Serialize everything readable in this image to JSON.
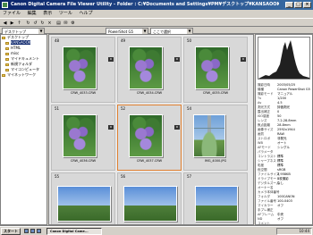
{
  "window": {
    "title": "Canon Digital Camera File Viewer Utility - Folder : C:¥Documents and Settings¥PM¥デスクトップ¥KANSAOOK"
  },
  "menu": [
    "ファイル",
    "編集",
    "表示",
    "ツール",
    "ヘルプ"
  ],
  "toolbar": {
    "address_value": "デスクトップ",
    "sort_value": "PowerShot G5",
    "filter_value": "ここで選択"
  },
  "tree": [
    {
      "label": "デスクトップ",
      "selected": false
    },
    {
      "label": "KANSAOOK",
      "selected": true
    },
    {
      "label": "HTML",
      "selected": false
    },
    {
      "label": "misc",
      "selected": false
    },
    {
      "label": "マイドキュメント",
      "selected": false
    },
    {
      "label": "新規フォルダ",
      "selected": false
    },
    {
      "label": "マイコンピュータ",
      "selected": false
    },
    {
      "label": "マイネットワーク",
      "selected": false
    }
  ],
  "thumbnails": [
    {
      "num": "48",
      "file": "CRW_4033.CRW",
      "kind": "flowers",
      "selected": false
    },
    {
      "num": "49",
      "file": "CRW_4034.CRW",
      "kind": "flowers",
      "selected": false
    },
    {
      "num": "50",
      "file": "CRW_4035.CRW",
      "kind": "flowers",
      "selected": false
    },
    {
      "num": "51",
      "file": "CRW_4036.CRW",
      "kind": "flowers",
      "selected": false
    },
    {
      "num": "52",
      "file": "CRW_4037.CRW",
      "kind": "flowers",
      "selected": true
    },
    {
      "num": "54",
      "file": "IMG_4000.JPG",
      "kind": "fountain",
      "selected": false
    },
    {
      "num": "55",
      "file": "",
      "kind": "landscape",
      "selected": false
    },
    {
      "num": "56",
      "file": "",
      "kind": "landscape",
      "selected": false
    },
    {
      "num": "57",
      "file": "",
      "kind": "landscape",
      "selected": false
    }
  ],
  "properties": [
    {
      "k": "撮影日時",
      "v": "2003/05/25"
    },
    {
      "k": "機種",
      "v": "Canon PowerShot G5"
    },
    {
      "k": "撮影モード",
      "v": "マニュアル"
    },
    {
      "k": "Tv",
      "v": "1/200"
    },
    {
      "k": "Av",
      "v": "4.5"
    },
    {
      "k": "測光方式",
      "v": "評価測光"
    },
    {
      "k": "露出補正",
      "v": "0"
    },
    {
      "k": "ISO感度",
      "v": "50"
    },
    {
      "k": "レンズ",
      "v": "7.2-28.8mm"
    },
    {
      "k": "焦点距離",
      "v": "28.8mm"
    },
    {
      "k": "画像サイズ",
      "v": "2592x1944"
    },
    {
      "k": "画質",
      "v": "RAW"
    },
    {
      "k": "ストロボ",
      "v": "非発光"
    },
    {
      "k": "WB",
      "v": "オート"
    },
    {
      "k": "AFモード",
      "v": "シングル"
    },
    {
      "k": "パラメータ",
      "v": ""
    },
    {
      "k": "コントラスト",
      "v": "標準"
    },
    {
      "k": "シャープネス",
      "v": "標準"
    },
    {
      "k": "彩度",
      "v": "標準"
    },
    {
      "k": "色空間",
      "v": "sRGB"
    },
    {
      "k": "ファイルサイズ",
      "v": "3,958KB"
    },
    {
      "k": "ドライブモード",
      "v": "1枚撮影"
    },
    {
      "k": "デジタルズーム",
      "v": "なし"
    },
    {
      "k": "オーナー名",
      "v": ""
    },
    {
      "k": "カメラ本体番号",
      "v": ""
    },
    {
      "k": "フォルダ",
      "v": "100CANON"
    },
    {
      "k": "ファイル番号",
      "v": "100-0403"
    },
    {
      "k": "マイカラー",
      "v": "オフ"
    },
    {
      "k": "手ブレ補正",
      "v": ""
    },
    {
      "k": "AFフレーム",
      "v": "中央"
    },
    {
      "k": "ND",
      "v": "オフ"
    },
    {
      "k": "コメント",
      "v": ""
    }
  ],
  "status": {
    "right": "1個のオブジェクト"
  },
  "taskbar": {
    "start_label": "スタート",
    "app_label": "Canon Digital Came...",
    "clock": "10:44"
  }
}
